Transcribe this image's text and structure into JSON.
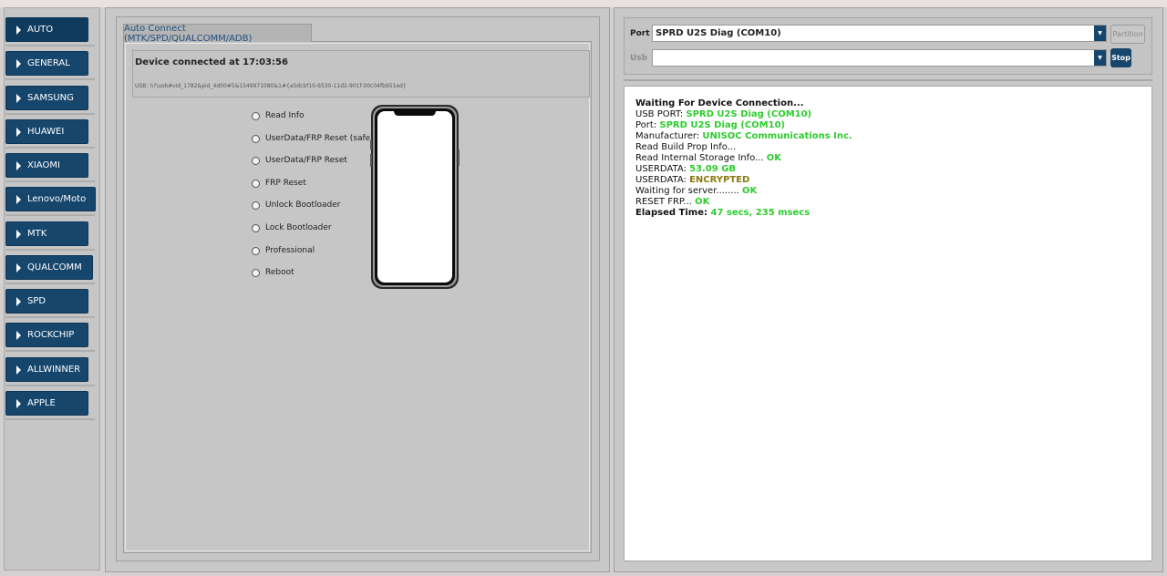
{
  "sidebar": {
    "items": [
      {
        "label": "AUTO"
      },
      {
        "label": "GENERAL"
      },
      {
        "label": "SAMSUNG"
      },
      {
        "label": "HUAWEI"
      },
      {
        "label": "XIAOMI"
      },
      {
        "label": "Lenovo/Moto"
      },
      {
        "label": "MTK"
      },
      {
        "label": "QUALCOMM"
      },
      {
        "label": "SPD"
      },
      {
        "label": "ROCKCHIP"
      },
      {
        "label": "ALLWINNER"
      },
      {
        "label": "APPLE"
      }
    ]
  },
  "main": {
    "tab_label": "Auto Connect (MTK/SPD/QUALCOMM/ADB)",
    "device_title": "Device connected at 17:03:56",
    "device_path": "USB: \\\\?\\usb#vid_1782&pid_4d00#5&1549971080&1#{a5dcbf10-6530-11d2-901f-00c04fb951ed}",
    "options": [
      {
        "label": "Read Info"
      },
      {
        "label": "UserData/FRP Reset (safe)"
      },
      {
        "label": "UserData/FRP Reset"
      },
      {
        "label": "FRP Reset"
      },
      {
        "label": "Unlock Bootloader"
      },
      {
        "label": "Lock Bootloader"
      },
      {
        "label": "Professional"
      },
      {
        "label": "Reboot"
      }
    ]
  },
  "right": {
    "port_label": "Port",
    "port_value": "SPRD U2S Diag (COM10)",
    "usb_label": "Usb",
    "usb_value": "",
    "partition_button": "Partition",
    "stop_button": "Stop",
    "log": {
      "waiting": "Waiting For Device Connection...",
      "usb_port_label": "USB PORT: ",
      "usb_port_value": "SPRD U2S Diag (COM10)",
      "port_label": "Port: ",
      "port_value": "SPRD U2S Diag (COM10)",
      "manufacturer_label": "Manufacturer: ",
      "manufacturer_value": "UNISOC Communications Inc.",
      "build_prop": "Read Build Prop Info...",
      "storage_label": "Read Internal Storage Info... ",
      "storage_value": "OK",
      "userdata1_label": "USERDATA: ",
      "userdata1_value": "53.09 GB",
      "userdata2_label": "USERDATA: ",
      "userdata2_value": "ENCRYPTED",
      "server_label": "Waiting for server........ ",
      "server_value": "OK",
      "frp_label": "RESET FRP... ",
      "frp_value": "OK",
      "elapsed_label": "Elapsed Time: ",
      "elapsed_value": "47 secs, 235 msecs"
    }
  },
  "colors": {
    "nav_button": "#17466d",
    "ok_text": "#2ecc2e",
    "encrypted_text": "#8a7a10",
    "tab_text": "#1f4f7e"
  }
}
